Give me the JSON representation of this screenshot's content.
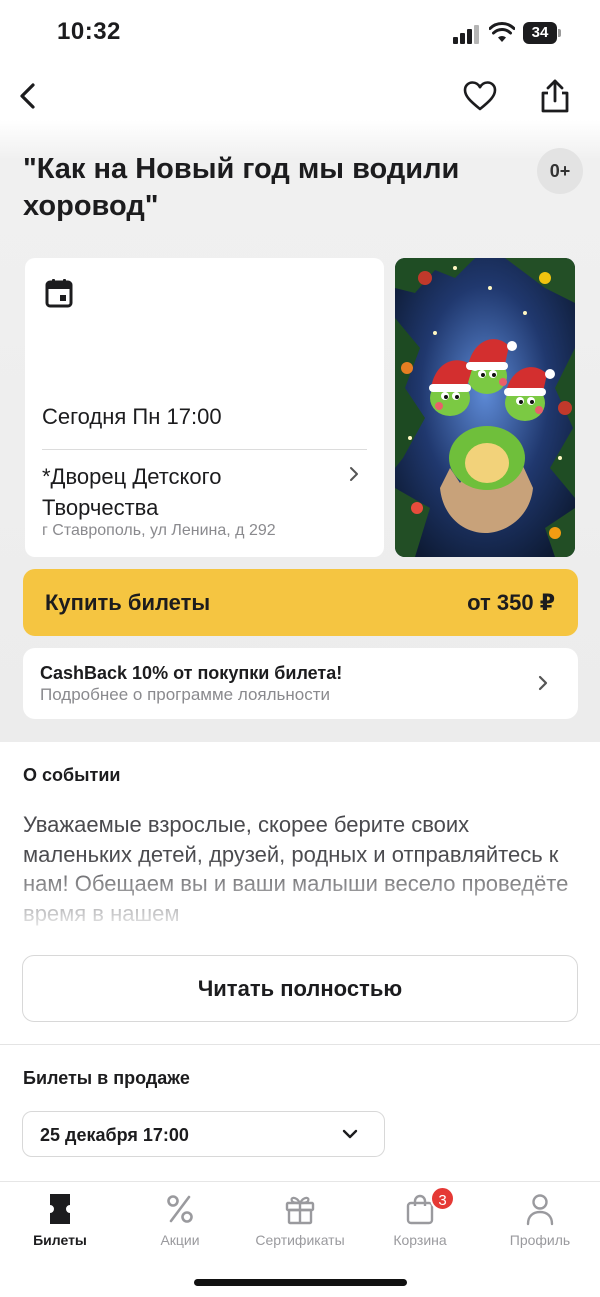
{
  "status_bar": {
    "time": "10:32",
    "battery": "34"
  },
  "nav": {
    "back_icon": "chevron-left-icon",
    "favorite_icon": "heart-icon",
    "share_icon": "share-icon"
  },
  "event": {
    "title": "\"Как на Новый год мы водили хоровод\"",
    "age_rating": "0+",
    "date_text": "Сегодня Пн 17:00",
    "venue_name": "*Дворец Детского Творчества",
    "venue_address": "г Ставрополь, ул Ленина, д 292"
  },
  "buy": {
    "label": "Купить билеты",
    "price": "от 350 ₽"
  },
  "cashback": {
    "title": "CashBack 10% от покупки билета!",
    "subtitle": "Подробнее о программе лояльности"
  },
  "about": {
    "heading": "О событии",
    "text": "Уважаемые взрослые, скорее берите своих маленьких детей, друзей, родных и отправляйтесь к нам! Обещаем вы и ваши малыши весело проведёте время в нашем",
    "read_more": "Читать полностью"
  },
  "tickets": {
    "heading": "Билеты в продаже",
    "selected_date": "25 декабря 17:00"
  },
  "tab_bar": {
    "tabs": [
      {
        "label": "Билеты",
        "icon": "ticket-icon",
        "active": true
      },
      {
        "label": "Акции",
        "icon": "percent-icon",
        "active": false
      },
      {
        "label": "Сертификаты",
        "icon": "gift-icon",
        "active": false
      },
      {
        "label": "Корзина",
        "icon": "cart-icon",
        "active": false
      },
      {
        "label": "Профиль",
        "icon": "profile-icon",
        "active": false
      }
    ],
    "cart_count": "3"
  },
  "colors": {
    "accent_yellow": "#f5c541",
    "badge_red": "#e53935",
    "background_grey": "#ececec"
  }
}
